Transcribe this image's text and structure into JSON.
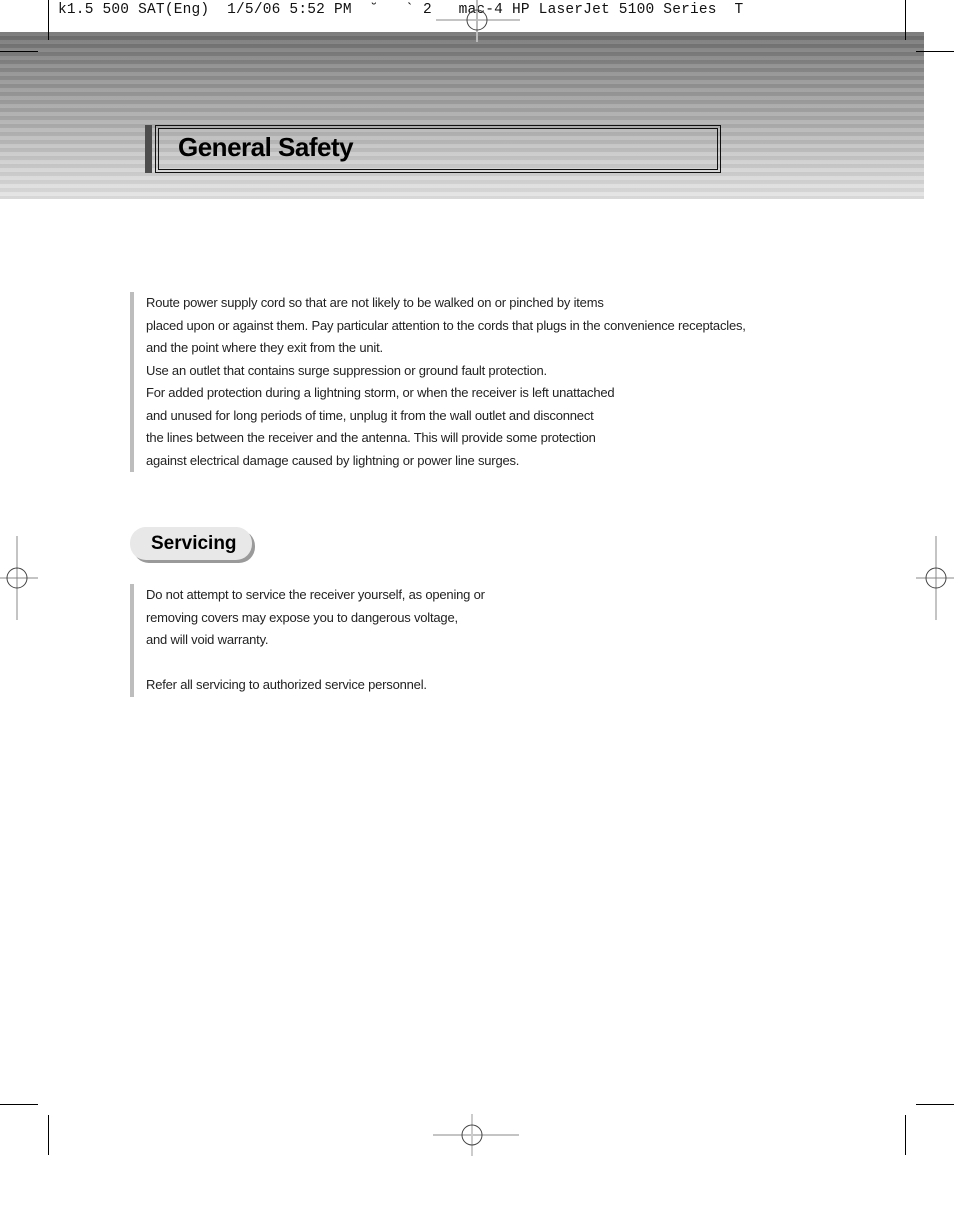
{
  "slug_line": "k1.5 500 SAT(Eng)  1/5/06 5:52 PM  ˘   ` 2   mac-4 HP LaserJet 5100 Series  T",
  "header": {
    "title": "General Safety"
  },
  "safety": {
    "lines": [
      "Route power supply cord so that are not likely to be walked on or pinched by items",
      "placed upon or against them. Pay particular attention to the cords that plugs in the convenience receptacles,",
      "and the point where they exit from the unit.",
      "Use an outlet that contains surge suppression or ground fault protection.",
      "For added protection during a lightning storm, or when the receiver is left unattached",
      "and unused for long periods of time, unplug it from the wall outlet and disconnect",
      "the lines between the receiver and the antenna. This will provide some protection",
      "against electrical damage caused by lightning or power line surges."
    ]
  },
  "servicing": {
    "heading": "Servicing",
    "lines": [
      "Do not attempt to service the receiver yourself, as opening or",
      "removing covers may expose you to dangerous voltage,",
      "and will void warranty."
    ],
    "note": "Refer all servicing to authorized service personnel."
  }
}
